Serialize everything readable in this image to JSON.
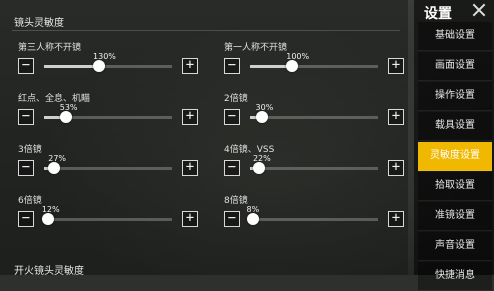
{
  "sidebar": {
    "title": "设置",
    "items": [
      {
        "label": "基础设置",
        "active": false
      },
      {
        "label": "画面设置",
        "active": false
      },
      {
        "label": "操作设置",
        "active": false
      },
      {
        "label": "载具设置",
        "active": false
      },
      {
        "label": "灵敏度设置",
        "active": true
      },
      {
        "label": "拾取设置",
        "active": false
      },
      {
        "label": "准镜设置",
        "active": false
      },
      {
        "label": "声音设置",
        "active": false
      },
      {
        "label": "快捷消息",
        "active": false
      }
    ]
  },
  "section_title": "镜头灵敏度",
  "section_title_2": "开火镜头灵敏度",
  "sliders": [
    {
      "label": "第三人称不开镜",
      "value_text": "130%",
      "fraction": 0.43
    },
    {
      "label": "第一人称不开镜",
      "value_text": "100%",
      "fraction": 0.33
    },
    {
      "label": "红点、全息、机瞄",
      "value_text": "53%",
      "fraction": 0.17
    },
    {
      "label": "2倍镜",
      "value_text": "30%",
      "fraction": 0.09
    },
    {
      "label": "3倍镜",
      "value_text": "27%",
      "fraction": 0.08
    },
    {
      "label": "4倍镜、VSS",
      "value_text": "22%",
      "fraction": 0.07
    },
    {
      "label": "6倍镜",
      "value_text": "12%",
      "fraction": 0.03
    },
    {
      "label": "8倍镜",
      "value_text": "8%",
      "fraction": 0.02
    }
  ],
  "buttons": {
    "minus": "−",
    "plus": "+"
  }
}
